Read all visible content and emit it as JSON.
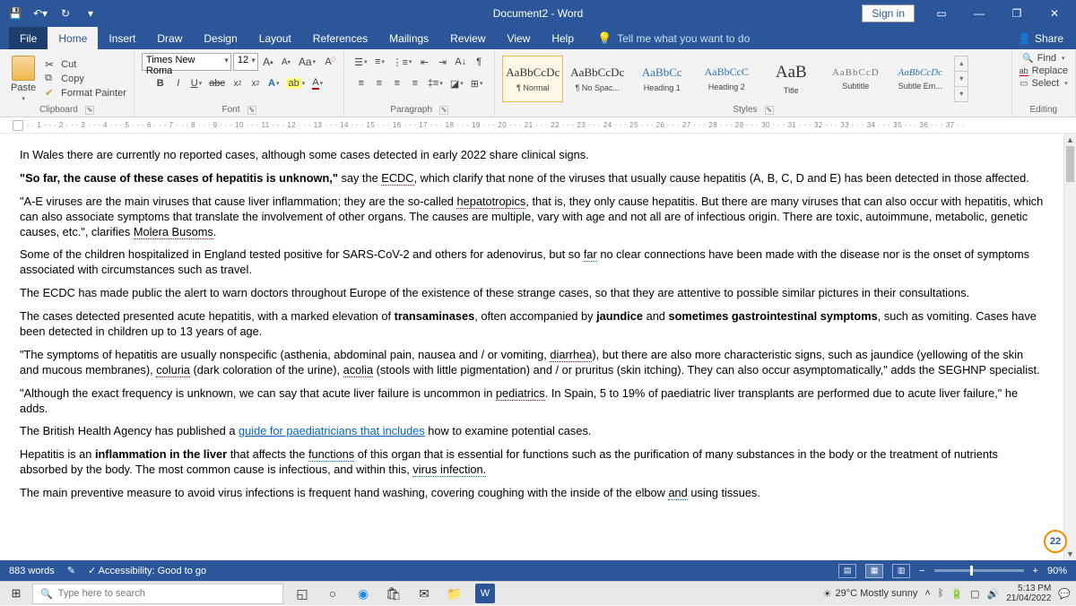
{
  "titlebar": {
    "title": "Document2 - Word",
    "signin": "Sign in"
  },
  "tabs": {
    "file": "File",
    "home": "Home",
    "insert": "Insert",
    "draw": "Draw",
    "design": "Design",
    "layout": "Layout",
    "references": "References",
    "mailings": "Mailings",
    "review": "Review",
    "view": "View",
    "help": "Help",
    "tellme": "Tell me what you want to do",
    "share": "Share"
  },
  "clipboard": {
    "paste": "Paste",
    "cut": "Cut",
    "copy": "Copy",
    "formatPainter": "Format Painter",
    "label": "Clipboard"
  },
  "font": {
    "name": "Times New Roma",
    "size": "12",
    "label": "Font"
  },
  "paragraph": {
    "label": "Paragraph"
  },
  "styles": {
    "label": "Styles",
    "items": [
      {
        "preview": "AaBbCcDc",
        "name": "¶ Normal",
        "cls": "sp-normal",
        "sel": true
      },
      {
        "preview": "AaBbCcDc",
        "name": "¶ No Spac...",
        "cls": "sp-normal"
      },
      {
        "preview": "AaBbCc",
        "name": "Heading 1",
        "cls": "sp-h1"
      },
      {
        "preview": "AaBbCcC",
        "name": "Heading 2",
        "cls": "sp-h2"
      },
      {
        "preview": "AaB",
        "name": "Title",
        "cls": "sp-title"
      },
      {
        "preview": "AaBbCcD",
        "name": "Subtitle",
        "cls": "sp-sub"
      },
      {
        "preview": "AaBbCcDc",
        "name": "Subtle Em...",
        "cls": "sp-se"
      }
    ]
  },
  "editing": {
    "find": "Find",
    "replace": "Replace",
    "select": "Select",
    "label": "Editing"
  },
  "ruler": "· · 1 · · · 2 · · · 3 · · · 4 · · · 5 · · · 6 · · · 7 · · · 8 · · · 9 · · · 10 · · · 11 · · · 12 · · · 13 · · · 14 · · · 15 · · · 16 · · · 17 · · · 18 · · · 19 · · · 20 · · · 21 · · · 22 · · · 23 · · · 24 · · · 25 · · · 26 · · · 27 · · · 28 · · · 29 · · · 30 · · · 31 · · · 32 · · · 33 · · · 34 · · · 35 · · · 36 · · · 37 · ·",
  "doc": {
    "p1": "In Wales there are currently no reported cases, although some cases detected in early 2022 share clinical signs.",
    "p2a": "\"So far, the cause of these cases of hepatitis is unknown,\"",
    "p2b": " say the ",
    "p2c": "ECDC",
    "p2d": ", which clarify that none of the viruses that usually cause hepatitis (A, B, C, D and E) has been detected in those affected.",
    "p3a": "\"A-E viruses are the main viruses that cause liver inflammation; they are the so-called ",
    "p3b": "hepatotropics",
    "p3c": ", that is, they only cause hepatitis. But there are many viruses that can also occur with hepatitis, which can also associate symptoms that translate the involvement of other organs. The causes are multiple, vary with age and not all are of infectious origin. There are toxic, autoimmune, metabolic, genetic causes, etc.\", clarifies ",
    "p3d": "Molera Busoms",
    "p3e": ".",
    "p4a": "Some of the children hospitalized in England tested positive for SARS-CoV-2 and others for adenovirus, but so ",
    "p4b": "far",
    "p4c": " no clear connections have been made with the disease nor is the onset of symptoms associated with circumstances such as travel.",
    "p5": "The ECDC has made public the alert to warn doctors throughout Europe of the existence of these strange cases, so that they are attentive to possible similar pictures in their consultations.",
    "p6a": "The cases detected presented acute hepatitis, with a marked elevation of ",
    "p6b": "transaminases",
    "p6c": ", often accompanied by ",
    "p6d": "jaundice",
    "p6e": " and ",
    "p6f": "sometimes gastrointestinal symptoms",
    "p6g": ", such as vomiting. Cases have been detected in children up to 13 years of age.",
    "p7a": "\"The symptoms of hepatitis are usually nonspecific (asthenia, abdominal pain, nausea and / or vomiting, ",
    "p7b": "diarrhea",
    "p7c": "), but there are also more characteristic signs, such as jaundice (yellowing of the skin and mucous membranes), ",
    "p7d": "coluria",
    "p7e": " (dark coloration of the urine), ",
    "p7f": "acolia",
    "p7g": " (stools with little pigmentation) and / or pruritus (skin itching). They can also occur asymptomatically,\" adds the SEGHNP specialist.",
    "p8a": "\"Although the exact frequency is unknown, we can say that acute liver failure is uncommon in ",
    "p8b": "pediatrics",
    "p8c": ". In Spain, 5 to 19% of paediatric liver transplants are performed due to acute liver failure,\" he adds.",
    "p9a": "The British Health Agency has published a ",
    "p9b": "guide for paediatricians that includes",
    "p9c": " how to examine potential cases.",
    "p10a": "Hepatitis is an ",
    "p10b": "inflammation in the liver",
    "p10c": " that affects the ",
    "p10d": "functions",
    "p10e": " of this organ that is essential for functions such as the purification of many substances in the body or the treatment of nutrients absorbed by the body. The most common cause is infectious, and within this, ",
    "p10f": "virus infection.",
    "p11a": "The main preventive measure to avoid virus infections is frequent hand washing, covering coughing with the inside of the elbow ",
    "p11b": "and",
    "p11c": " using tissues."
  },
  "badge": "22",
  "status": {
    "words": "883 words",
    "acc": "Accessibility: Good to go",
    "zoom": "90%"
  },
  "taskbar": {
    "search": "Type here to search",
    "weather": "29°C  Mostly sunny",
    "time": "5:13 PM",
    "date": "21/04/2022"
  }
}
